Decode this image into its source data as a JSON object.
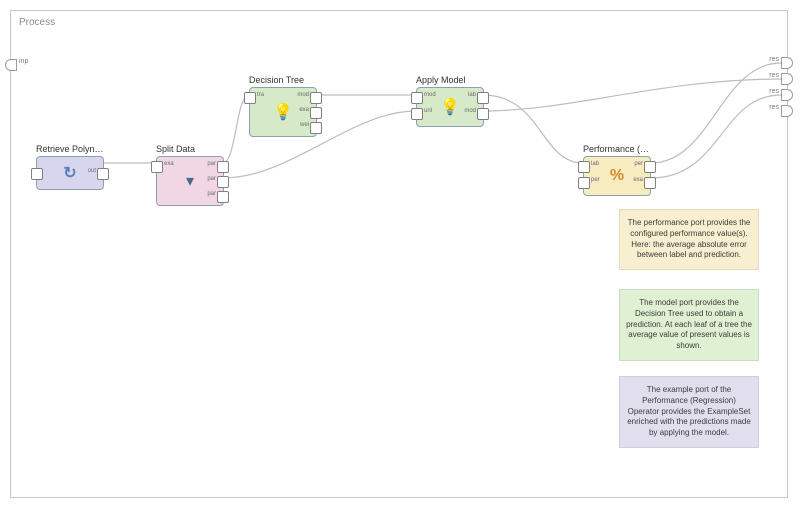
{
  "process": {
    "label": "Process",
    "input_ports": [
      {
        "label": "inp"
      }
    ],
    "output_ports": [
      {
        "label": "res"
      },
      {
        "label": "res"
      },
      {
        "label": "res"
      },
      {
        "label": "res"
      }
    ]
  },
  "operators": {
    "retrieve": {
      "title": "Retrieve Polyno...",
      "color": "#d7d6ee",
      "icon": "↩",
      "input_ports": [
        {
          "label": ""
        }
      ],
      "output_ports": [
        {
          "label": "out"
        }
      ]
    },
    "split": {
      "title": "Split Data",
      "color": "#f1d7e4",
      "icon": "▼",
      "input_ports": [
        {
          "label": "exa"
        }
      ],
      "output_ports": [
        {
          "label": "par"
        },
        {
          "label": "par"
        },
        {
          "label": "par"
        }
      ]
    },
    "tree": {
      "title": "Decision Tree",
      "color": "#d6e9c8",
      "icon": "💡",
      "input_ports": [
        {
          "label": "tra"
        }
      ],
      "output_ports": [
        {
          "label": "mod"
        },
        {
          "label": "exa"
        },
        {
          "label": "wei"
        }
      ]
    },
    "apply": {
      "title": "Apply Model",
      "color": "#d6e9c8",
      "icon": "💡",
      "input_ports": [
        {
          "label": "mod"
        },
        {
          "label": "unl"
        }
      ],
      "output_ports": [
        {
          "label": "lab"
        },
        {
          "label": "mod"
        }
      ]
    },
    "perf": {
      "title": "Performance (Re...",
      "color": "#f6ecc0",
      "icon": "%",
      "input_ports": [
        {
          "label": "lab"
        },
        {
          "label": "per"
        }
      ],
      "output_ports": [
        {
          "label": "per"
        },
        {
          "label": "exa"
        }
      ]
    }
  },
  "notes": {
    "perf_note": {
      "color": "#f7efcf",
      "text": "The performance port provides the configured performance value(s). Here: the average absolute error between label and prediction."
    },
    "model_note": {
      "color": "#dff0d3",
      "text": "The model port provides the Decision Tree used to obtain a prediction. At each leaf of a tree the average value of present values is shown."
    },
    "example_note": {
      "color": "#e1dfee",
      "text": "The example port of the Performance (Regression) Operator provides the ExampleSet enriched with the predictions made by applying the model."
    }
  }
}
